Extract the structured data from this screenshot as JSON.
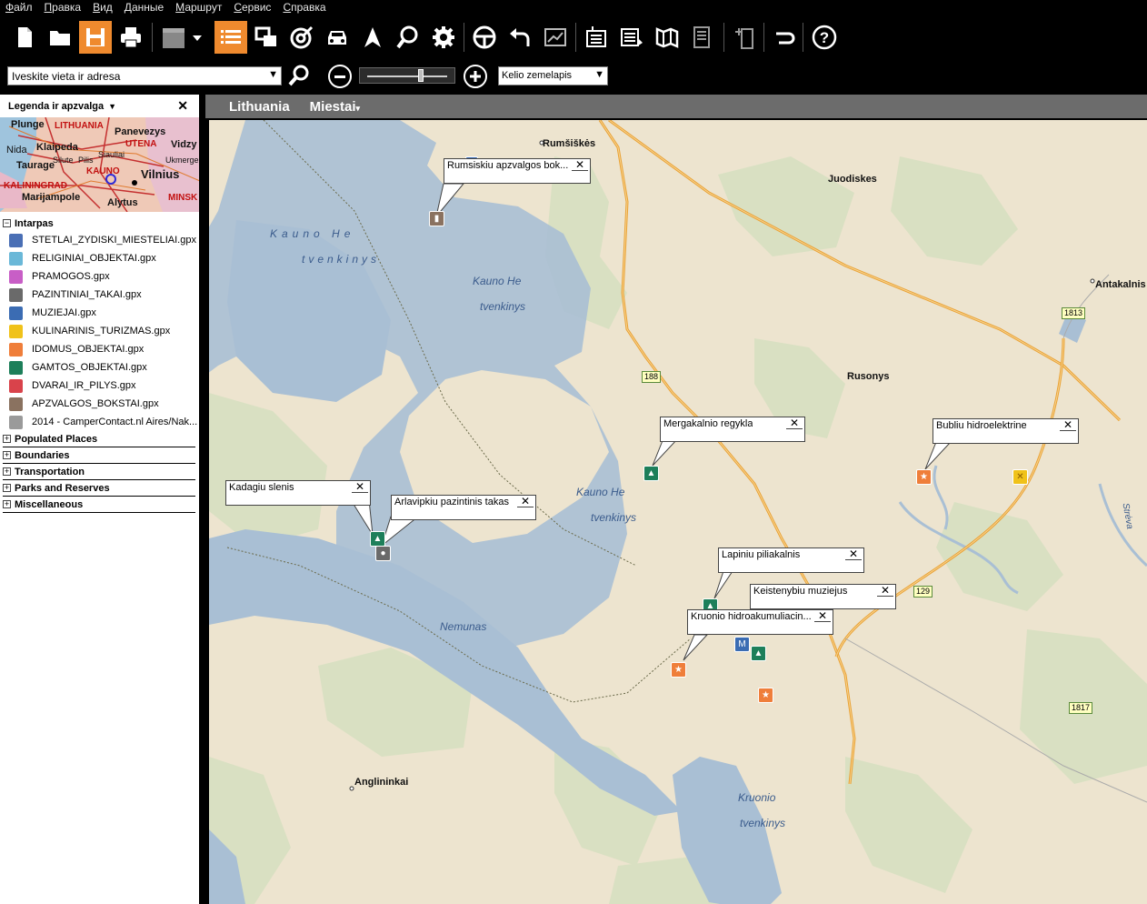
{
  "menu": [
    "Файл",
    "Правка",
    "Вид",
    "Данные",
    "Маршрут",
    "Сервис",
    "Справка"
  ],
  "toolbar": {
    "icons": [
      "new-file-icon",
      "open-folder-icon",
      "save-icon",
      "print-icon",
      "layer-icon",
      "list-icon",
      "copy-windows-icon",
      "gps-track-icon",
      "car-icon",
      "navigation-arrow-icon",
      "find-place-icon",
      "settings-icon",
      "steering-wheel-icon",
      "undo-icon",
      "chart-icon",
      "import-icon",
      "export-icon",
      "map-book-icon",
      "report-icon",
      "device-transfer-icon",
      "magnet-icon",
      "help-icon"
    ]
  },
  "search": {
    "address_value": "Iveskite vieta ir adresa",
    "map_type": "Kelio zemelapis",
    "zoom_level": 0.67
  },
  "legend": {
    "title": "Legenda ir apzvalga",
    "overview_labels": [
      "Plunge",
      "LITHUANIA",
      "Panevezys",
      "Nida",
      "Klaipeda",
      "UTENA",
      "Vidzy",
      "Silute",
      "Siauliai",
      "Taurage",
      "Pilis",
      "Ukmerge",
      "Vilnius",
      "KALININGRAD",
      "KAUNO",
      "Marijampole",
      "Alytus",
      "MINSK"
    ],
    "intarpas_label": "Intarpas",
    "layers": [
      {
        "name": "STETLAI_ZYDISKI_MIESTELIAI.gpx",
        "color": "#4a6fb5",
        "icon": "star-of-david-icon"
      },
      {
        "name": "RELIGINIAI_OBJEKTAI.gpx",
        "color": "#6ab8d8",
        "icon": "church-icon"
      },
      {
        "name": "PRAMOGOS.gpx",
        "color": "#c85ec6",
        "icon": "entertainment-star-icon"
      },
      {
        "name": "PAZINTINIAI_TAKAI.gpx",
        "color": "#6a6a6a",
        "icon": "footprint-icon"
      },
      {
        "name": "MUZIEJAI.gpx",
        "color": "#3b6cb3",
        "icon": "museum-icon"
      },
      {
        "name": "KULINARINIS_TURIZMAS.gpx",
        "color": "#f0c21a",
        "icon": "cutlery-icon"
      },
      {
        "name": "IDOMUS_OBJEKTAI.gpx",
        "color": "#ef7e3a",
        "icon": "interesting-star-icon"
      },
      {
        "name": "GAMTOS_OBJEKTAI.gpx",
        "color": "#1d7f5a",
        "icon": "nature-tent-icon"
      },
      {
        "name": "DVARAI_IR_PILYS.gpx",
        "color": "#d9434b",
        "icon": "castle-icon"
      },
      {
        "name": "APZVALGOS_BOKSTAI.gpx",
        "color": "#8a7260",
        "icon": "tower-icon"
      },
      {
        "name": "2014 - CamperContact.nl Aires/Nak...",
        "color": "#9a9a9a",
        "icon": "camper-icon"
      }
    ],
    "groups": [
      "Populated Places",
      "Boundaries",
      "Transportation",
      "Parks and Reserves",
      "Miscellaneous"
    ]
  },
  "map": {
    "breadcrumb": [
      "Lithuania",
      "Miestai"
    ],
    "places": [
      "Rumšiškės",
      "Juodiskes",
      "Antakalnis",
      "Rusonys",
      "Anglininkai"
    ],
    "water_labels": [
      "Kauno He",
      "tvenkinys",
      "Kauno He",
      "tvenkinys",
      "Kauno He",
      "tvenkinys",
      "Nemunas",
      "Kruonio",
      "tvenkinys",
      "Strėva"
    ],
    "road_numbers": [
      "188",
      "1813",
      "129",
      "1817"
    ],
    "callouts": [
      "Rumsiskiu apzvalgos bok...",
      "Mergakalnio regykla",
      "Bubliu hidroelektrine",
      "Kadagiu slenis",
      "Arlavipkiu pazintinis takas",
      "Lapiniu piliakalnis",
      "Keistenybiu muziejus",
      "Kruonio hidroakumuliacin..."
    ]
  }
}
